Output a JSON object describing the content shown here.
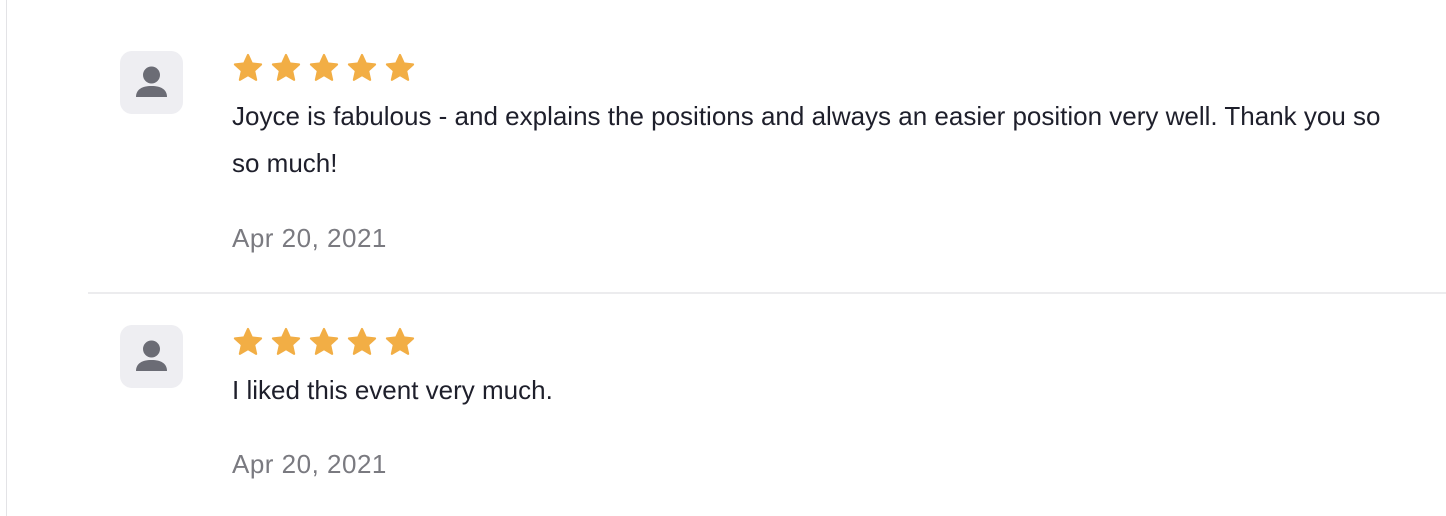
{
  "colors": {
    "star": "#F2AE45",
    "avatar_bg": "#EEEEF2",
    "avatar_icon": "#6B6C75",
    "text": "#1E1F2B",
    "date": "#7A7A80",
    "divider": "#ECECEE"
  },
  "reviews": [
    {
      "avatar_icon": "user-icon",
      "rating": 5,
      "text": "Joyce is fabulous - and explains the positions and always an easier position very well. Thank you so so much!",
      "date": "Apr 20, 2021"
    },
    {
      "avatar_icon": "user-icon",
      "rating": 5,
      "text": "I liked this event very much.",
      "date": "Apr 20, 2021"
    }
  ]
}
